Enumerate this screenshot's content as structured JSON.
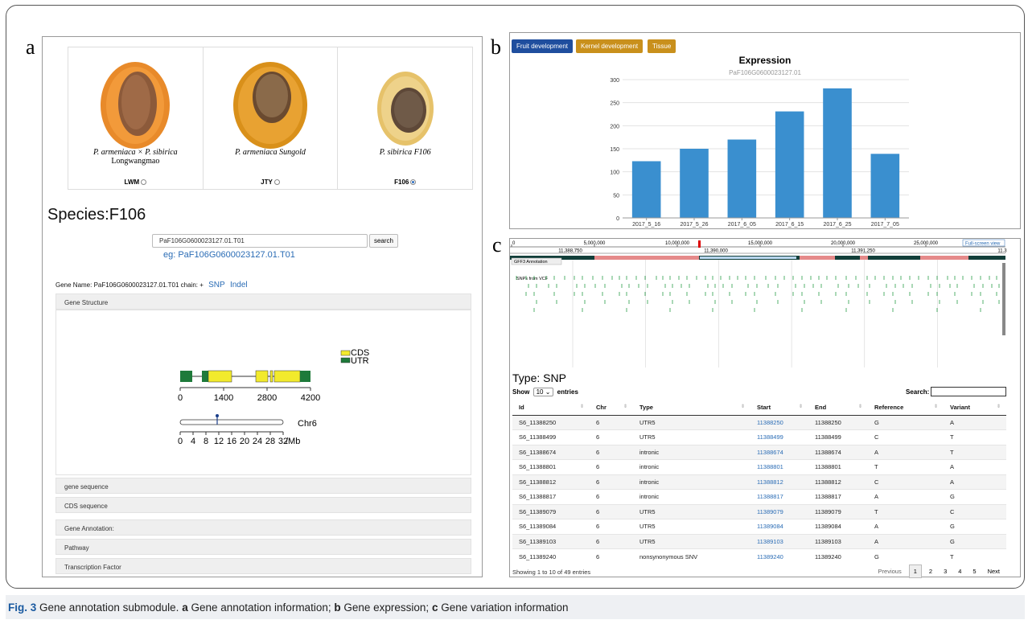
{
  "panel_a": {
    "letter": "a",
    "fruits": [
      {
        "caption_line1": "P. armeniaca × P. sibirica",
        "caption_line2": "Longwangmao",
        "radio_label": "LWM",
        "selected": false
      },
      {
        "caption_line1": "P. armeniaca Sungold",
        "caption_line2": "",
        "radio_label": "JTY",
        "selected": false
      },
      {
        "caption_line1": "P. sibirica F106",
        "caption_line2": "",
        "radio_label": "F106",
        "selected": true
      }
    ],
    "species_label": "Species:F106",
    "gene_input_value": "PaF106G0600023127.01.T01",
    "search_button": "search",
    "example": "eg: PaF106G0600023127.01.T01",
    "gene_name_text": "Gene Name: PaF106G0600023127.01.T01 chain: +",
    "snp_link": "SNP",
    "indel_link": "Indel",
    "accordion": {
      "gene_structure": "Gene Structure",
      "gene_sequence": "gene sequence",
      "cds_sequence": "CDS sequence",
      "gene_annotation": "Gene Annotation:",
      "pathway": "Pathway",
      "transcription_factor": "Transcription Factor"
    },
    "structure": {
      "legend_cds": "CDS",
      "legend_utr": "UTR",
      "gene_axis_ticks": [
        "0",
        "1400",
        "2800",
        "4200"
      ],
      "chrom_label": "Chr6",
      "chrom_axis_ticks": [
        "0",
        "4",
        "8",
        "12",
        "16",
        "20",
        "24",
        "28",
        "32"
      ],
      "chrom_unit": "/Mb",
      "cds_color": "#f2ea2c",
      "utr_color": "#1e7a3a"
    }
  },
  "panel_b": {
    "letter": "b",
    "tabs": [
      "Fruit development",
      "Kernel development",
      "Tissue"
    ],
    "chart_data": {
      "type": "bar",
      "title": "Expression",
      "subtitle": "PaF106G0600023127.01",
      "categories": [
        "2017_5_16",
        "2017_5_26",
        "2017_6_05",
        "2017_6_15",
        "2017_6_25",
        "2017_7_05"
      ],
      "values": [
        123,
        150,
        170,
        231,
        281,
        139
      ],
      "ylim": [
        0,
        300
      ],
      "yticks": [
        "0",
        "50",
        "100",
        "150",
        "200",
        "250",
        "300"
      ],
      "grid": true,
      "bar_color": "#3a8fcf"
    }
  },
  "panel_c": {
    "letter": "c",
    "browser": {
      "ruler_ticks": [
        "0",
        "5,000,000",
        "10,000,000",
        "15,000,000",
        "20,000,000",
        "25,000,000"
      ],
      "fullscreen": "Full-screen view",
      "zoom_ticks": [
        "11,388,750",
        "11,390,000",
        "11,391,250",
        "11.3"
      ],
      "track1": "GFF3 Annotation",
      "track2": "SNPs from VCF"
    },
    "type_label": "Type: SNP",
    "show_prefix": "Show",
    "show_value": "10",
    "show_suffix": "entries",
    "search_label": "Search:",
    "columns": [
      "Id",
      "Chr",
      "Type",
      "Start",
      "End",
      "Reference",
      "Variant"
    ],
    "rows": [
      [
        "S6_11388250",
        "6",
        "UTR5",
        "11388250",
        "11388250",
        "G",
        "A"
      ],
      [
        "S6_11388499",
        "6",
        "UTR5",
        "11388499",
        "11388499",
        "C",
        "T"
      ],
      [
        "S6_11388674",
        "6",
        "intronic",
        "11388674",
        "11388674",
        "A",
        "T"
      ],
      [
        "S6_11388801",
        "6",
        "intronic",
        "11388801",
        "11388801",
        "T",
        "A"
      ],
      [
        "S6_11388812",
        "6",
        "intronic",
        "11388812",
        "11388812",
        "C",
        "A"
      ],
      [
        "S6_11388817",
        "6",
        "intronic",
        "11388817",
        "11388817",
        "A",
        "G"
      ],
      [
        "S6_11389079",
        "6",
        "UTR5",
        "11389079",
        "11389079",
        "T",
        "C"
      ],
      [
        "S6_11389084",
        "6",
        "UTR5",
        "11389084",
        "11389084",
        "A",
        "G"
      ],
      [
        "S6_11389103",
        "6",
        "UTR5",
        "11389103",
        "11389103",
        "A",
        "G"
      ],
      [
        "S6_11389240",
        "6",
        "nonsynonymous SNV",
        "11389240",
        "11389240",
        "G",
        "T"
      ]
    ],
    "info": "Showing 1 to 10 of 49 entries",
    "pager": {
      "previous": "Previous",
      "pages": [
        "1",
        "2",
        "3",
        "4",
        "5"
      ],
      "next": "Next"
    }
  },
  "caption": {
    "fig": "Fig. 3",
    "text1": "Gene annotation submodule.",
    "a": "a",
    "text2": "Gene annotation information;",
    "b": "b",
    "text3": "Gene expression;",
    "c": "c",
    "text4": "Gene variation information"
  }
}
